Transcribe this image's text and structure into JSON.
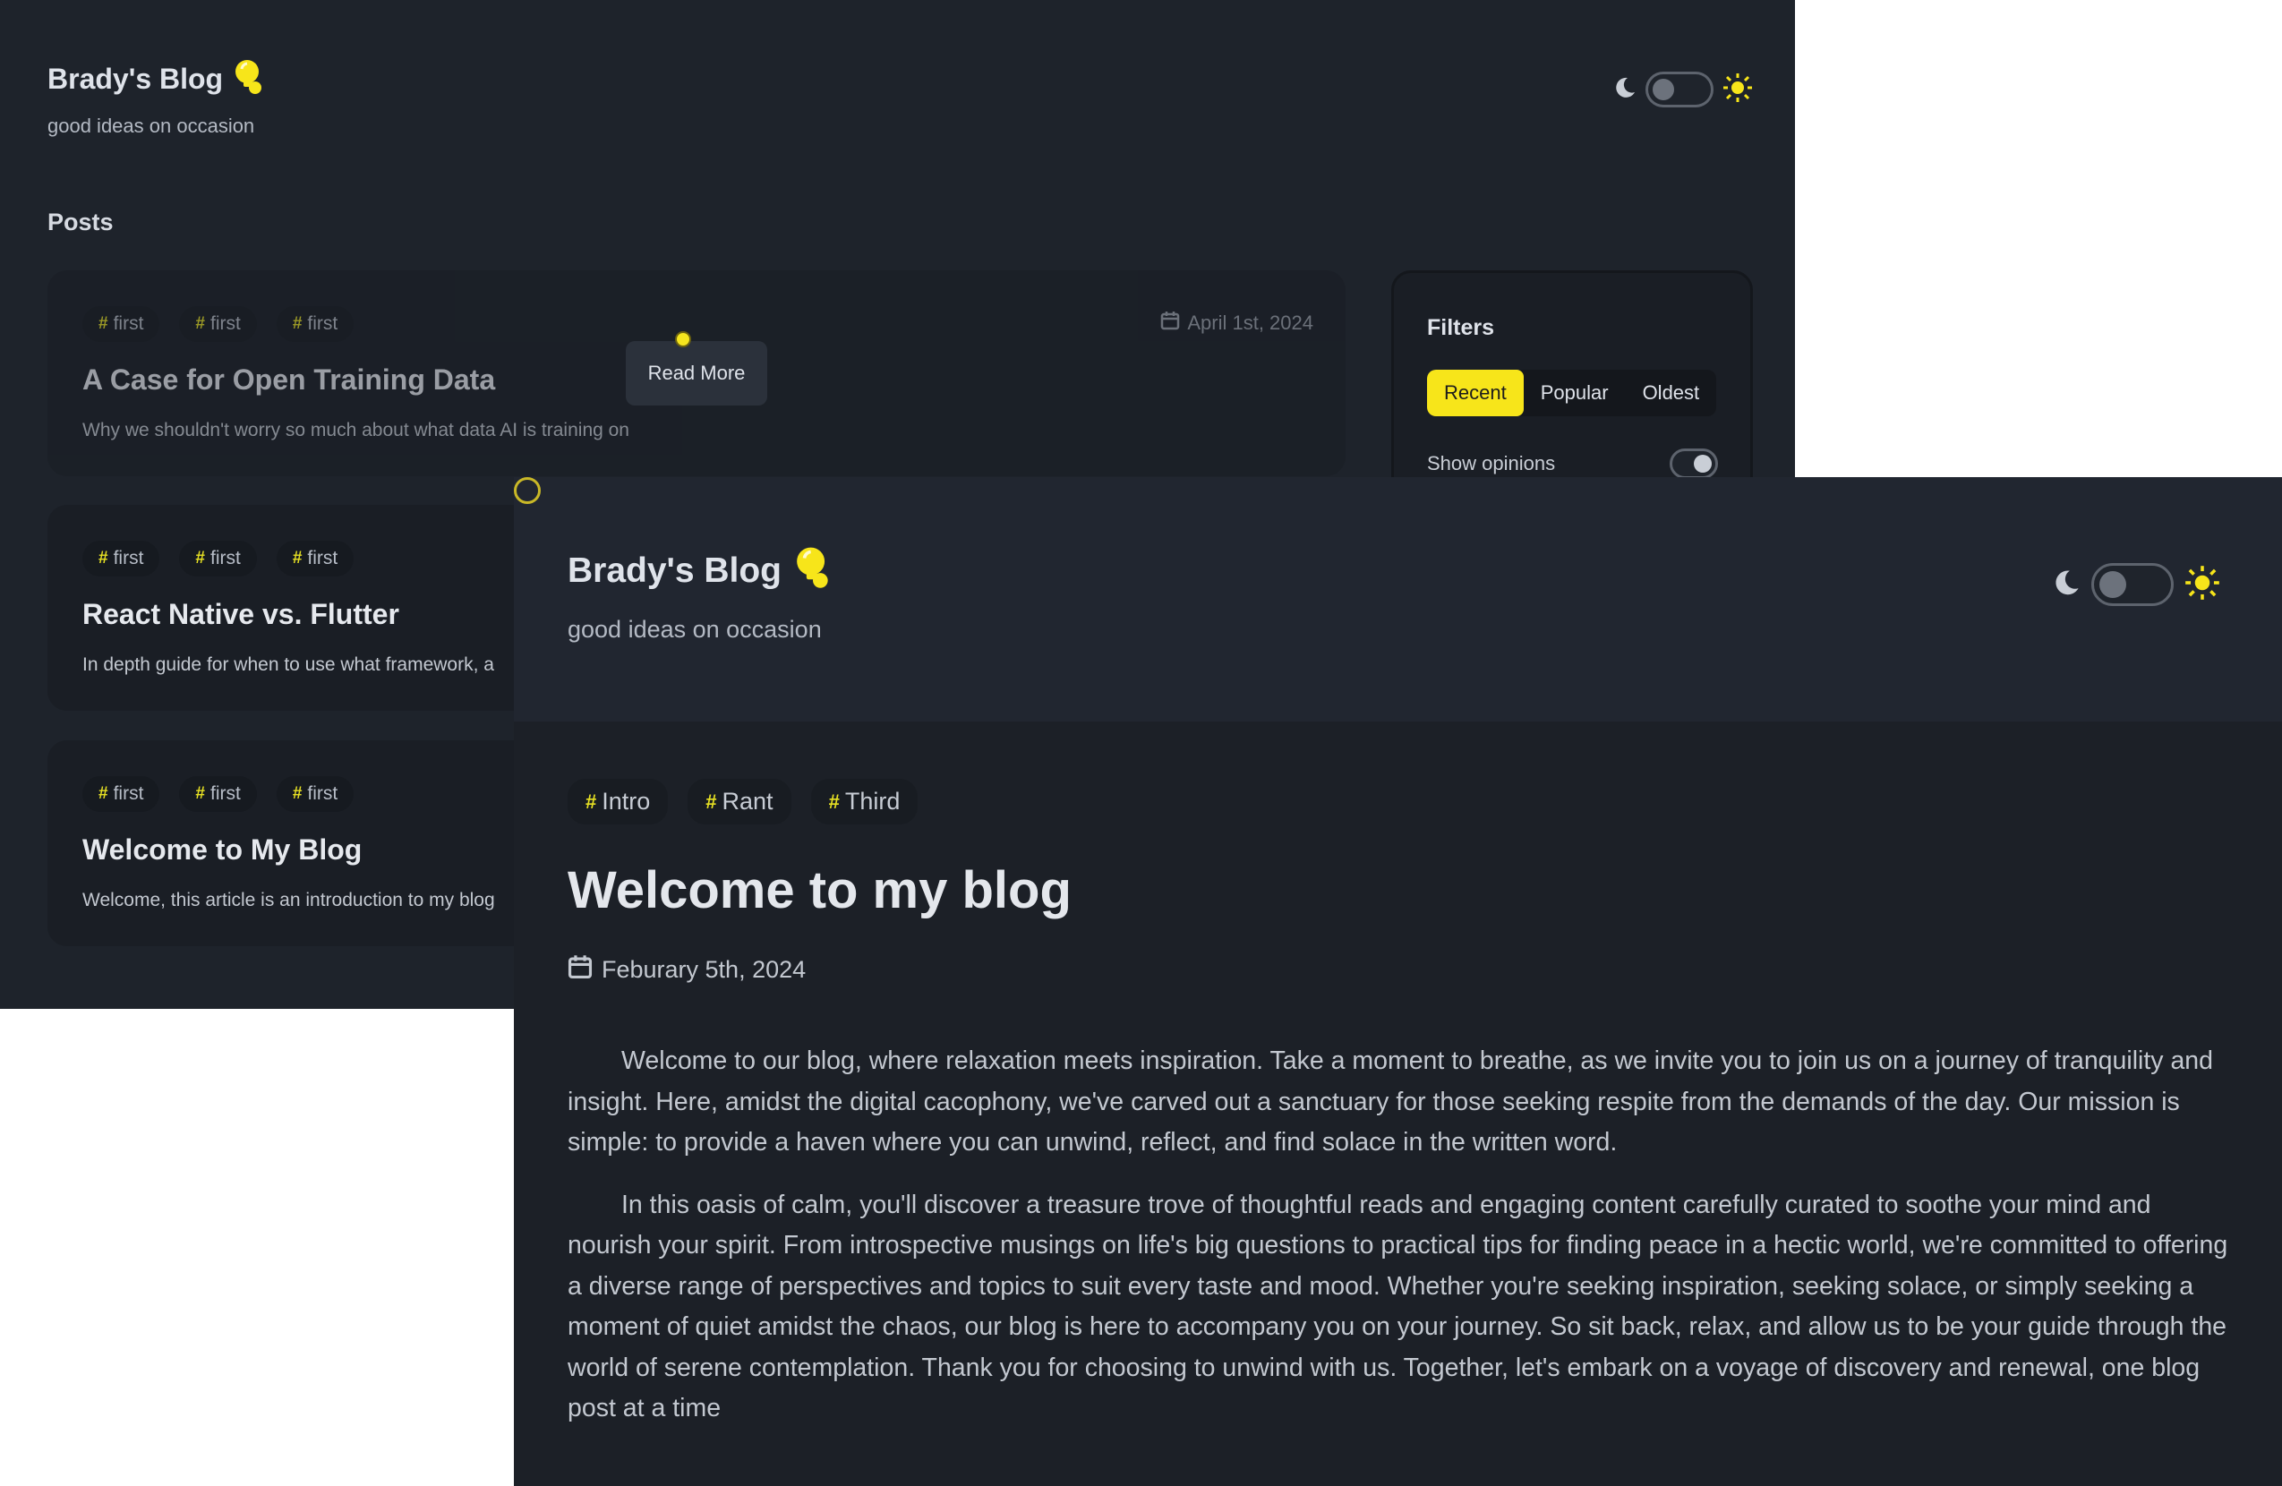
{
  "back_window": {
    "site_title": "Brady's Blog",
    "subtitle": "good ideas on occasion",
    "posts_heading": "Posts",
    "read_more_label": "Read More",
    "cards": [
      {
        "tags": [
          "first",
          "first",
          "first"
        ],
        "title": "A Case for Open Training Data",
        "description": "Why we shouldn't worry so much about what data AI is training on",
        "date": "April 1st, 2024"
      },
      {
        "tags": [
          "first",
          "first",
          "first"
        ],
        "title": "React Native vs. Flutter",
        "description": "In depth guide for when to use what framework, a"
      },
      {
        "tags": [
          "first",
          "first",
          "first"
        ],
        "title": "Welcome to My Blog",
        "description": "Welcome, this article is an introduction to my blog"
      }
    ],
    "filters": {
      "title": "Filters",
      "options": [
        "Recent",
        "Popular",
        "Oldest"
      ],
      "selected": "Recent",
      "show_opinions_label": "Show opinions",
      "show_opinions_on": true
    }
  },
  "front_window": {
    "site_title": "Brady's Blog",
    "subtitle": "good ideas on occasion",
    "tags": [
      "Intro",
      "Rant",
      "Third"
    ],
    "post_title": "Welcome to my blog",
    "post_date": "Feburary 5th, 2024",
    "paragraphs": [
      "Welcome to our blog, where relaxation meets inspiration. Take a moment to breathe, as we invite you to join us on a journey of tranquility and insight. Here, amidst the digital cacophony, we've carved out a sanctuary for those seeking respite from the demands of the day. Our mission is simple: to provide a haven where you can unwind, reflect, and find solace in the written word.",
      "In this oasis of calm, you'll discover a treasure trove of thoughtful reads and engaging content carefully curated to soothe your mind and nourish your spirit. From introspective musings on life's big questions to practical tips for finding peace in a hectic world, we're committed to offering a diverse range of perspectives and topics to suit every taste and mood. Whether you're seeking inspiration, seeking solace, or simply seeking a moment of quiet amidst the chaos, our blog is here to accompany you on your journey. So sit back, relax, and allow us to be your guide through the world of serene contemplation. Thank you for choosing to unwind with us. Together, let's embark on a voyage of discovery and renewal, one blog post at a time"
    ]
  },
  "theme": {
    "dark_mode": true
  },
  "colors": {
    "accent": "#f7e51a",
    "background": "#1e232b",
    "card": "#1a1e25"
  },
  "icons": [
    "lightbulb-icon",
    "moon-icon",
    "sun-icon",
    "calendar-icon",
    "hash-icon"
  ]
}
